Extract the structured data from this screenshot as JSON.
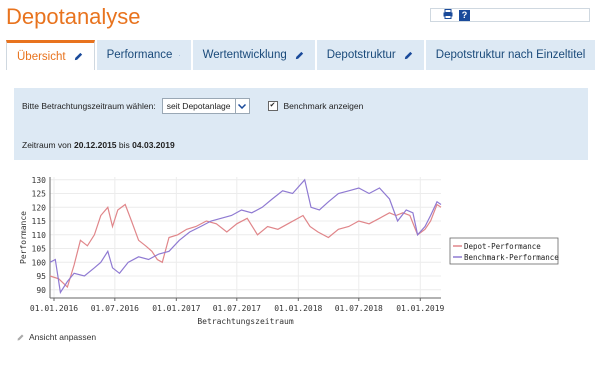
{
  "page": {
    "title": "Depotanalyse",
    "print_icon": "printer-icon",
    "help_icon": "help-icon",
    "help_text": "?"
  },
  "tabs": [
    {
      "label": "Übersicht",
      "active": true,
      "icon": "pencil-icon"
    },
    {
      "label": "Performance",
      "active": false,
      "icon": "pencil-icon"
    },
    {
      "label": "Wertentwicklung",
      "active": false,
      "icon": "pencil-icon"
    },
    {
      "label": "Depotstruktur",
      "active": false,
      "icon": "pencil-icon"
    },
    {
      "label": "Depotstruktur nach Einzeltitel",
      "active": false,
      "icon": ""
    }
  ],
  "filter": {
    "period_label": "Bitte Betrachtungszeitraum wählen:",
    "period_value": "seit Depotanlage",
    "benchmark_label": "Benchmark anzeigen",
    "benchmark_checked": true,
    "range_prefix": "Zeitraum von",
    "range_from": "20.12.2015",
    "range_mid": "bis",
    "range_to": "04.03.2019"
  },
  "adjust_label": "Ansicht anpassen",
  "colors": {
    "accent": "#e8731e",
    "tab_bg": "#dde9f4",
    "depot": "#e0868a",
    "benchmark": "#8f7ad2"
  },
  "chart_data": {
    "type": "line",
    "xlabel": "Betrachtungszeitraum",
    "ylabel": "Performance",
    "ylim": [
      87,
      131
    ],
    "yticks": [
      90,
      95,
      100,
      105,
      110,
      115,
      120,
      125,
      130
    ],
    "xticks": [
      "01.01.2016",
      "01.07.2016",
      "01.01.2017",
      "01.07.2017",
      "01.01.2018",
      "01.07.2018",
      "01.01.2019"
    ],
    "xlim": [
      "2015-12-20",
      "2019-03-04"
    ],
    "grid": true,
    "legend_position": "right",
    "series": [
      {
        "name": "Depot-Performance",
        "color": "#e0868a",
        "x": [
          "2015-12-20",
          "2016-01-15",
          "2016-02-10",
          "2016-03-01",
          "2016-03-20",
          "2016-04-10",
          "2016-05-01",
          "2016-05-20",
          "2016-06-10",
          "2016-06-24",
          "2016-07-10",
          "2016-08-01",
          "2016-08-20",
          "2016-09-10",
          "2016-10-01",
          "2016-10-20",
          "2016-11-05",
          "2016-11-20",
          "2016-12-10",
          "2017-01-05",
          "2017-02-01",
          "2017-03-01",
          "2017-04-01",
          "2017-05-01",
          "2017-06-01",
          "2017-07-01",
          "2017-08-01",
          "2017-09-01",
          "2017-10-01",
          "2017-11-01",
          "2017-12-01",
          "2018-01-15",
          "2018-02-05",
          "2018-03-01",
          "2018-04-01",
          "2018-05-01",
          "2018-06-01",
          "2018-07-01",
          "2018-08-01",
          "2018-09-01",
          "2018-10-01",
          "2018-10-20",
          "2018-11-10",
          "2018-12-01",
          "2018-12-24",
          "2019-01-15",
          "2019-02-01",
          "2019-02-20",
          "2019-03-04"
        ],
        "y": [
          95,
          94,
          91,
          99,
          108,
          106,
          110,
          117,
          120,
          113,
          119,
          121,
          115,
          108,
          106,
          104,
          101,
          100,
          109,
          110,
          112,
          113,
          115,
          114,
          111,
          114,
          116,
          110,
          113,
          112,
          114,
          117,
          113,
          111,
          109,
          112,
          113,
          115,
          114,
          116,
          118,
          117,
          118,
          117,
          110,
          112,
          115,
          121,
          120
        ]
      },
      {
        "name": "Benchmark-Performance",
        "color": "#8f7ad2",
        "x": [
          "2015-12-20",
          "2016-01-05",
          "2016-01-20",
          "2016-02-10",
          "2016-03-01",
          "2016-04-01",
          "2016-05-01",
          "2016-05-20",
          "2016-06-10",
          "2016-06-24",
          "2016-07-15",
          "2016-08-10",
          "2016-09-10",
          "2016-10-10",
          "2016-11-10",
          "2016-12-10",
          "2017-01-10",
          "2017-02-10",
          "2017-03-15",
          "2017-04-15",
          "2017-05-15",
          "2017-06-15",
          "2017-07-15",
          "2017-08-15",
          "2017-09-15",
          "2017-10-15",
          "2017-11-15",
          "2017-12-15",
          "2018-01-20",
          "2018-02-08",
          "2018-03-05",
          "2018-04-01",
          "2018-05-01",
          "2018-06-01",
          "2018-07-01",
          "2018-08-01",
          "2018-09-01",
          "2018-10-01",
          "2018-10-25",
          "2018-11-20",
          "2018-12-10",
          "2018-12-24",
          "2019-01-15",
          "2019-02-01",
          "2019-02-20",
          "2019-03-04"
        ],
        "y": [
          100,
          101,
          89,
          93,
          96,
          95,
          98,
          100,
          104,
          98,
          96,
          100,
          102,
          101,
          103,
          104,
          108,
          111,
          113,
          115,
          116,
          117,
          119,
          118,
          120,
          123,
          126,
          125,
          130,
          120,
          119,
          122,
          125,
          126,
          127,
          125,
          127,
          123,
          115,
          119,
          118,
          110,
          113,
          117,
          122,
          121
        ]
      }
    ]
  }
}
